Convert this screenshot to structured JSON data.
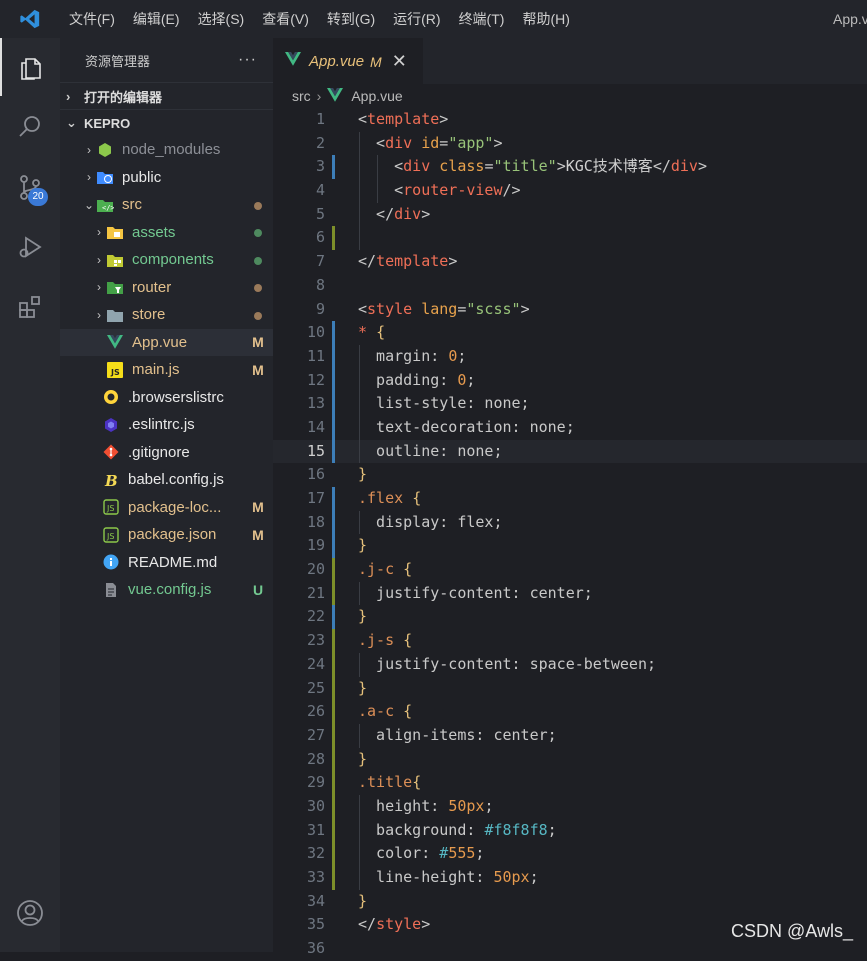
{
  "menu": [
    "文件(F)",
    "编辑(E)",
    "选择(S)",
    "查看(V)",
    "转到(G)",
    "运行(R)",
    "终端(T)",
    "帮助(H)"
  ],
  "window_title": "App.vue",
  "activity": {
    "scm_badge": "20"
  },
  "sidebar": {
    "title": "资源管理器",
    "more": "···",
    "open_editors": "打开的编辑器",
    "project": "KEPRO",
    "tree": [
      {
        "label": "node_modules",
        "color": "#8c8f96",
        "icon": "node-folder",
        "indent": 1,
        "twist": "›",
        "status": "",
        "dot": ""
      },
      {
        "label": "public",
        "color": "#e8e8e8",
        "icon": "public-folder",
        "indent": 1,
        "twist": "›",
        "status": "",
        "dot": ""
      },
      {
        "label": "src",
        "color": "#e2c08d",
        "icon": "src-folder",
        "indent": 1,
        "twist": "⌄",
        "status": "",
        "dot": "#9a7a5a"
      },
      {
        "label": "assets",
        "color": "#73c991",
        "icon": "assets-folder",
        "indent": 2,
        "twist": "›",
        "status": "",
        "dot": "#4e8a5f"
      },
      {
        "label": "components",
        "color": "#73c991",
        "icon": "components-folder",
        "indent": 2,
        "twist": "›",
        "status": "",
        "dot": "#4e8a5f"
      },
      {
        "label": "router",
        "color": "#e2c08d",
        "icon": "router-folder",
        "indent": 2,
        "twist": "›",
        "status": "",
        "dot": "#9a7a5a"
      },
      {
        "label": "store",
        "color": "#e2c08d",
        "icon": "store-folder",
        "indent": 2,
        "twist": "›",
        "status": "",
        "dot": "#9a7a5a"
      },
      {
        "label": "App.vue",
        "color": "#e2c08d",
        "icon": "vue-file",
        "indent": 2,
        "twist": "",
        "status": "M",
        "status_color": "#e2c08d",
        "selected": true
      },
      {
        "label": "main.js",
        "color": "#e2c08d",
        "icon": "js-file",
        "indent": 2,
        "twist": "",
        "status": "M",
        "status_color": "#e2c08d"
      },
      {
        "label": ".browserslistrc",
        "color": "#e8e8e8",
        "icon": "browserslist-file",
        "indent": 1,
        "twist": "",
        "status": ""
      },
      {
        "label": ".eslintrc.js",
        "color": "#e8e8e8",
        "icon": "eslint-file",
        "indent": 1,
        "twist": "",
        "status": ""
      },
      {
        "label": ".gitignore",
        "color": "#e8e8e8",
        "icon": "git-file",
        "indent": 1,
        "twist": "",
        "status": ""
      },
      {
        "label": "babel.config.js",
        "color": "#e8e8e8",
        "icon": "babel-file",
        "indent": 1,
        "twist": "",
        "status": ""
      },
      {
        "label": "package-loc...",
        "color": "#e2c08d",
        "icon": "npm-file",
        "indent": 1,
        "twist": "",
        "status": "M",
        "status_color": "#e2c08d"
      },
      {
        "label": "package.json",
        "color": "#e2c08d",
        "icon": "npm-file",
        "indent": 1,
        "twist": "",
        "status": "M",
        "status_color": "#e2c08d"
      },
      {
        "label": "README.md",
        "color": "#e8e8e8",
        "icon": "info-file",
        "indent": 1,
        "twist": "",
        "status": ""
      },
      {
        "label": "vue.config.js",
        "color": "#73c991",
        "icon": "vue-config-file",
        "indent": 1,
        "twist": "",
        "status": "U",
        "status_color": "#73c991"
      }
    ]
  },
  "tab": {
    "label": "App.vue",
    "modified": "M",
    "close": "✕"
  },
  "breadcrumb": {
    "folder": "src",
    "sep": "›",
    "file": "App.vue"
  },
  "current_line": 15,
  "code": [
    {
      "n": "1",
      "g": "",
      "tokens": [
        [
          "t-punc",
          "<"
        ],
        [
          "t-tag",
          "template"
        ],
        [
          "t-punc",
          ">"
        ]
      ],
      "guides": 0
    },
    {
      "n": "2",
      "g": "",
      "tokens": [
        [
          "t-punc",
          "  <"
        ],
        [
          "t-tag",
          "div"
        ],
        [
          "t-attr",
          " id"
        ],
        [
          "t-punc",
          "="
        ],
        [
          "t-str",
          "\"app\""
        ],
        [
          "t-punc",
          ">"
        ]
      ],
      "guides": 1
    },
    {
      "n": "3",
      "g": "#3d7eb8",
      "tokens": [
        [
          "t-punc",
          "    <"
        ],
        [
          "t-tag",
          "div"
        ],
        [
          "t-attr",
          " class"
        ],
        [
          "t-punc",
          "="
        ],
        [
          "t-str",
          "\"title\""
        ],
        [
          "t-punc",
          ">"
        ],
        [
          "t-text",
          "KGC技术博客"
        ],
        [
          "t-punc",
          "</"
        ],
        [
          "t-tag",
          "div"
        ],
        [
          "t-punc",
          ">"
        ]
      ],
      "guides": 2
    },
    {
      "n": "4",
      "g": "",
      "tokens": [
        [
          "t-punc",
          "    <"
        ],
        [
          "t-tag",
          "router-view"
        ],
        [
          "t-punc",
          "/>"
        ]
      ],
      "guides": 2
    },
    {
      "n": "5",
      "g": "",
      "tokens": [
        [
          "t-punc",
          "  </"
        ],
        [
          "t-tag",
          "div"
        ],
        [
          "t-punc",
          ">"
        ]
      ],
      "guides": 1
    },
    {
      "n": "6",
      "g": "#7d8f2a",
      "tokens": [],
      "guides": 1
    },
    {
      "n": "7",
      "g": "",
      "tokens": [
        [
          "t-punc",
          "</"
        ],
        [
          "t-tag",
          "template"
        ],
        [
          "t-punc",
          ">"
        ]
      ],
      "guides": 0
    },
    {
      "n": "8",
      "g": "",
      "tokens": [],
      "guides": 0
    },
    {
      "n": "9",
      "g": "",
      "tokens": [
        [
          "t-punc",
          "<"
        ],
        [
          "t-tag",
          "style"
        ],
        [
          "t-attr",
          " lang"
        ],
        [
          "t-punc",
          "="
        ],
        [
          "t-str",
          "\"scss\""
        ],
        [
          "t-punc",
          ">"
        ]
      ],
      "guides": 0
    },
    {
      "n": "10",
      "g": "#3d7eb8",
      "tokens": [
        [
          "t-tag",
          "*"
        ],
        [
          "t-punc",
          " "
        ],
        [
          "t-brace",
          "{"
        ]
      ],
      "guides": 0
    },
    {
      "n": "11",
      "g": "#3d7eb8",
      "tokens": [
        [
          "t-prop",
          "  margin"
        ],
        [
          "t-punc",
          ": "
        ],
        [
          "t-num",
          "0"
        ],
        [
          "t-punc",
          ";"
        ]
      ],
      "guides": 1
    },
    {
      "n": "12",
      "g": "#3d7eb8",
      "tokens": [
        [
          "t-prop",
          "  padding"
        ],
        [
          "t-punc",
          ": "
        ],
        [
          "t-num",
          "0"
        ],
        [
          "t-punc",
          ";"
        ]
      ],
      "guides": 1
    },
    {
      "n": "13",
      "g": "#3d7eb8",
      "tokens": [
        [
          "t-prop",
          "  list-style"
        ],
        [
          "t-punc",
          ": none;"
        ]
      ],
      "guides": 1
    },
    {
      "n": "14",
      "g": "#3d7eb8",
      "tokens": [
        [
          "t-prop",
          "  text-decoration"
        ],
        [
          "t-punc",
          ": none;"
        ]
      ],
      "guides": 1
    },
    {
      "n": "15",
      "g": "#3d7eb8",
      "tokens": [
        [
          "t-prop",
          "  outline"
        ],
        [
          "t-punc",
          ": none;"
        ]
      ],
      "guides": 1
    },
    {
      "n": "16",
      "g": "",
      "tokens": [
        [
          "t-brace",
          "}"
        ]
      ],
      "guides": 0
    },
    {
      "n": "17",
      "g": "#3d7eb8",
      "tokens": [
        [
          "t-sel",
          ".flex"
        ],
        [
          "t-punc",
          " "
        ],
        [
          "t-brace",
          "{"
        ]
      ],
      "guides": 0
    },
    {
      "n": "18",
      "g": "#3d7eb8",
      "tokens": [
        [
          "t-prop",
          "  display"
        ],
        [
          "t-punc",
          ": flex;"
        ]
      ],
      "guides": 1
    },
    {
      "n": "19",
      "g": "#3d7eb8",
      "tokens": [
        [
          "t-brace",
          "}"
        ]
      ],
      "guides": 0
    },
    {
      "n": "20",
      "g": "#7d8f2a",
      "tokens": [
        [
          "t-sel",
          ".j-c"
        ],
        [
          "t-punc",
          " "
        ],
        [
          "t-brace",
          "{"
        ]
      ],
      "guides": 0
    },
    {
      "n": "21",
      "g": "#7d8f2a",
      "tokens": [
        [
          "t-prop",
          "  justify-content"
        ],
        [
          "t-punc",
          ": center;"
        ]
      ],
      "guides": 1
    },
    {
      "n": "22",
      "g": "#3d7eb8",
      "tokens": [
        [
          "t-brace",
          "}"
        ]
      ],
      "guides": 0
    },
    {
      "n": "23",
      "g": "#7d8f2a",
      "tokens": [
        [
          "t-sel",
          ".j-s"
        ],
        [
          "t-punc",
          " "
        ],
        [
          "t-brace",
          "{"
        ]
      ],
      "guides": 0
    },
    {
      "n": "24",
      "g": "#7d8f2a",
      "tokens": [
        [
          "t-prop",
          "  justify-content"
        ],
        [
          "t-punc",
          ": space-between;"
        ]
      ],
      "guides": 1
    },
    {
      "n": "25",
      "g": "#7d8f2a",
      "tokens": [
        [
          "t-brace",
          "}"
        ]
      ],
      "guides": 0
    },
    {
      "n": "26",
      "g": "#7d8f2a",
      "tokens": [
        [
          "t-sel",
          ".a-c"
        ],
        [
          "t-punc",
          " "
        ],
        [
          "t-brace",
          "{"
        ]
      ],
      "guides": 0
    },
    {
      "n": "27",
      "g": "#7d8f2a",
      "tokens": [
        [
          "t-prop",
          "  align-items"
        ],
        [
          "t-punc",
          ": center;"
        ]
      ],
      "guides": 1
    },
    {
      "n": "28",
      "g": "#7d8f2a",
      "tokens": [
        [
          "t-brace",
          "}"
        ]
      ],
      "guides": 0
    },
    {
      "n": "29",
      "g": "#7d8f2a",
      "tokens": [
        [
          "t-sel",
          ".title"
        ],
        [
          "t-brace",
          "{"
        ]
      ],
      "guides": 0
    },
    {
      "n": "30",
      "g": "#7d8f2a",
      "tokens": [
        [
          "t-prop",
          "  height"
        ],
        [
          "t-punc",
          ": "
        ],
        [
          "t-num",
          "50px"
        ],
        [
          "t-punc",
          ";"
        ]
      ],
      "guides": 1
    },
    {
      "n": "31",
      "g": "#7d8f2a",
      "tokens": [
        [
          "t-prop",
          "  background"
        ],
        [
          "t-punc",
          ": "
        ],
        [
          "t-hex",
          "#f8f8f8"
        ],
        [
          "t-punc",
          ";"
        ]
      ],
      "guides": 1
    },
    {
      "n": "32",
      "g": "#7d8f2a",
      "tokens": [
        [
          "t-prop",
          "  color"
        ],
        [
          "t-punc",
          ": "
        ],
        [
          "t-hex",
          "#"
        ],
        [
          "t-num",
          "555"
        ],
        [
          "t-punc",
          ";"
        ]
      ],
      "guides": 1
    },
    {
      "n": "33",
      "g": "#7d8f2a",
      "tokens": [
        [
          "t-prop",
          "  line-height"
        ],
        [
          "t-punc",
          ": "
        ],
        [
          "t-num",
          "50px"
        ],
        [
          "t-punc",
          ";"
        ]
      ],
      "guides": 1
    },
    {
      "n": "34",
      "g": "",
      "tokens": [
        [
          "t-brace",
          "}"
        ]
      ],
      "guides": 0
    },
    {
      "n": "35",
      "g": "",
      "tokens": [
        [
          "t-punc",
          "</"
        ],
        [
          "t-tag",
          "style"
        ],
        [
          "t-punc",
          ">"
        ]
      ],
      "guides": 0
    },
    {
      "n": "36",
      "g": "",
      "tokens": [],
      "guides": 0
    }
  ],
  "watermark": "CSDN @Awls_",
  "colors": {
    "accent": "#3a79d6",
    "modified": "#e2c08d",
    "untracked": "#73c991"
  }
}
